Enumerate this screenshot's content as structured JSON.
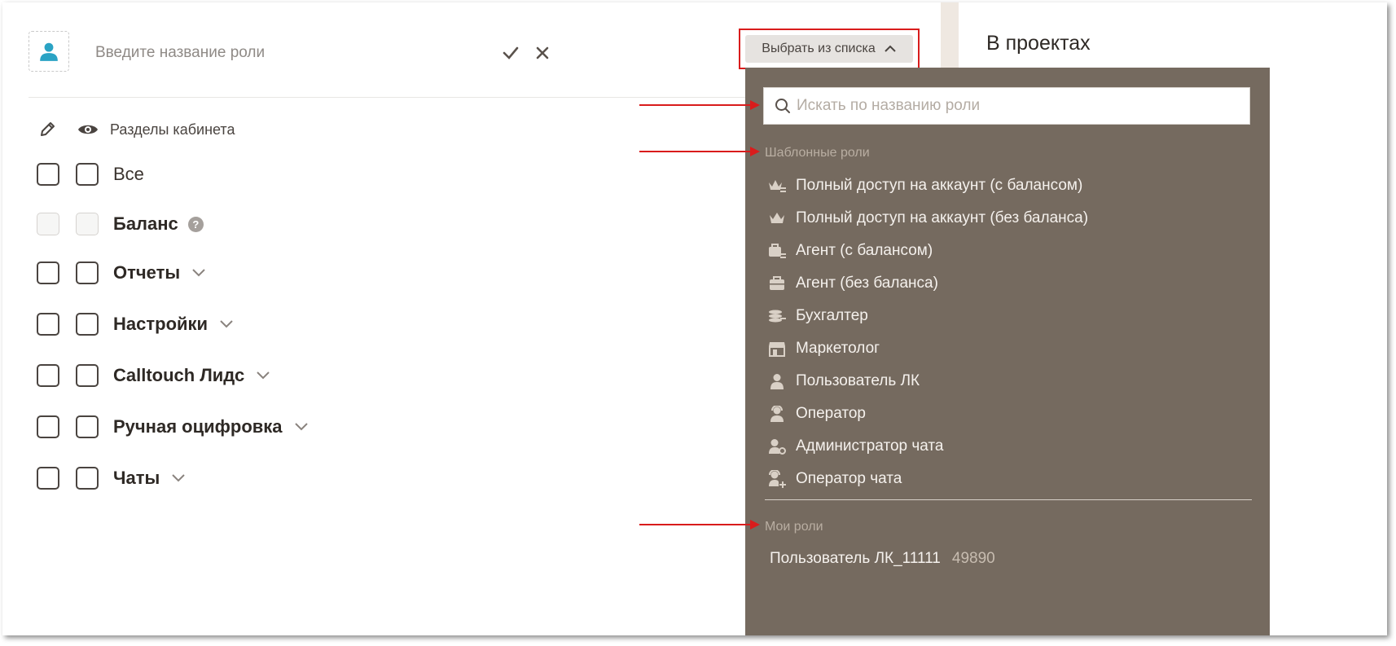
{
  "role": {
    "placeholder": "Введите название роли"
  },
  "sections_header": "Разделы кабинета",
  "rows": [
    {
      "label": "Все",
      "plain": true
    },
    {
      "label": "Баланс",
      "disabled": true,
      "help": "?"
    },
    {
      "label": "Отчеты",
      "expandable": true
    },
    {
      "label": "Настройки",
      "expandable": true
    },
    {
      "label": "Calltouch Лидс",
      "expandable": true
    },
    {
      "label": "Ручная оцифровка",
      "expandable": true
    },
    {
      "label": "Чаты",
      "expandable": true
    }
  ],
  "select_button": {
    "label": "Выбрать из списка"
  },
  "projects_title": "В проектах",
  "dropdown": {
    "search_placeholder": "Искать по названию роли",
    "templates_title": "Шаблонные роли",
    "templates": [
      {
        "label": "Полный доступ на аккаунт (с балансом)",
        "icon": "crown-balance-icon"
      },
      {
        "label": "Полный доступ на аккаунт (без баланса)",
        "icon": "crown-icon"
      },
      {
        "label": "Агент (с балансом)",
        "icon": "briefcase-balance-icon"
      },
      {
        "label": "Агент (без баланса)",
        "icon": "briefcase-icon"
      },
      {
        "label": "Бухгалтер",
        "icon": "coins-icon"
      },
      {
        "label": "Маркетолог",
        "icon": "store-icon"
      },
      {
        "label": "Пользователь ЛК",
        "icon": "user-icon"
      },
      {
        "label": "Оператор",
        "icon": "operator-icon"
      },
      {
        "label": "Администратор чата",
        "icon": "chat-admin-icon"
      },
      {
        "label": "Оператор чата",
        "icon": "chat-operator-icon"
      }
    ],
    "my_roles_title": "Мои роли",
    "my_roles": [
      {
        "label": "Пользователь ЛК_11111",
        "id": "49890"
      }
    ]
  },
  "colors": {
    "dropdown_bg": "#756a5f",
    "highlight": "#d91c1c",
    "avatar": "#2aa3c4"
  }
}
